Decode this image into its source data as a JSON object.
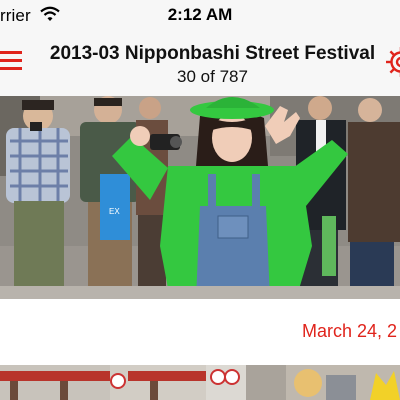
{
  "status_bar": {
    "carrier": "rrier",
    "time": "2:12 AM"
  },
  "nav": {
    "title": "2013-03 Nipponbashi Street Festival",
    "subtitle": "30 of 787"
  },
  "photo": {
    "bag_label": "EX"
  },
  "date_label": "March 24, 2",
  "colors": {
    "accent": "#e0241c",
    "bar_background": "#f7f7f7",
    "hoodie_green": "#34c840"
  },
  "icons": {
    "wifi": "wifi-icon",
    "menu": "hamburger-menu-icon",
    "settings": "gear-icon"
  }
}
